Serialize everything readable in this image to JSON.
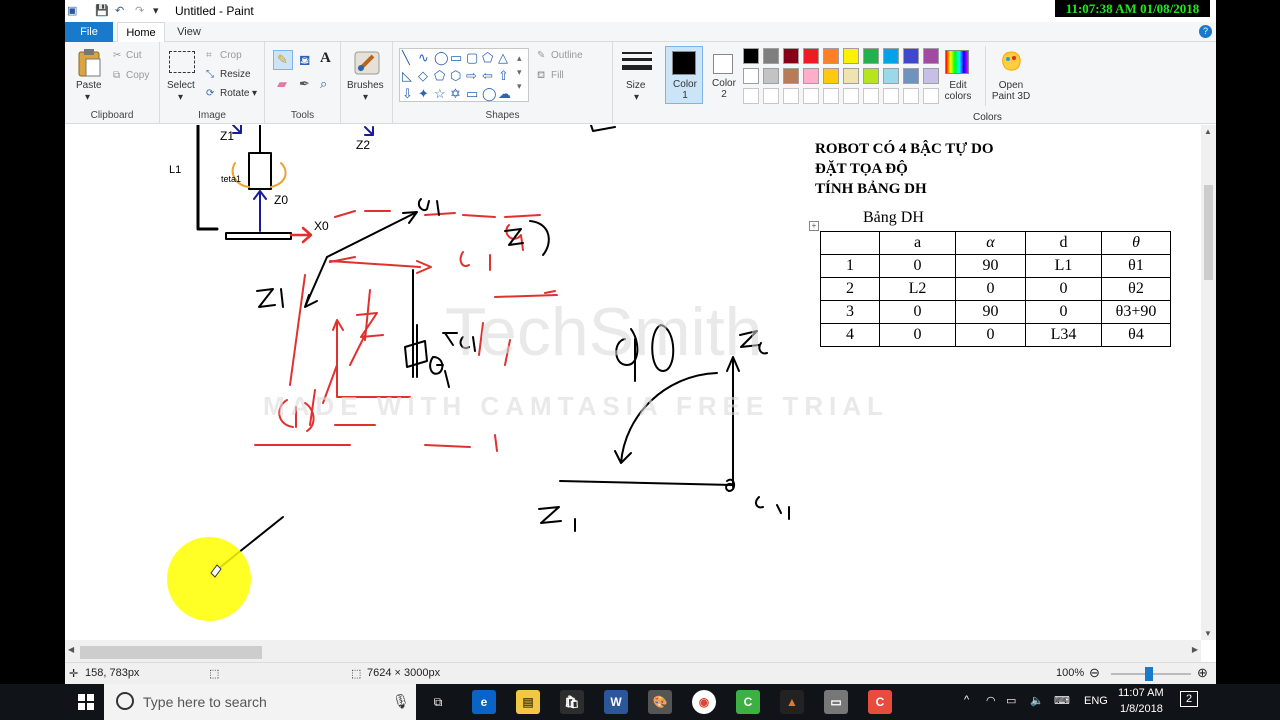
{
  "clock_overlay": "11:07:38 AM 01/08/2018",
  "window": {
    "title": "Untitled - Paint"
  },
  "tabs": {
    "file": "File",
    "home": "Home",
    "view": "View"
  },
  "ribbon": {
    "clipboard": {
      "paste": "Paste",
      "cut": "Cut",
      "copy": "Copy",
      "label": "Clipboard"
    },
    "image": {
      "select": "Select",
      "crop": "Crop",
      "resize": "Resize",
      "rotate": "Rotate",
      "label": "Image"
    },
    "tools": {
      "label": "Tools"
    },
    "brushes": "Brushes",
    "shapes": {
      "outline": "Outline",
      "fill": "Fill",
      "label": "Shapes"
    },
    "size": "Size",
    "color1": "Color 1",
    "color2": "Color 2",
    "edit_colors": "Edit colors",
    "open_paint3d": "Open Paint 3D",
    "colors_label": "Colors",
    "palette_row1": [
      "#000000",
      "#7f7f7f",
      "#880015",
      "#ed1c24",
      "#ff7f27",
      "#fff200",
      "#22b14c",
      "#00a2e8",
      "#3f48cc",
      "#a349a4"
    ],
    "palette_row2": [
      "#ffffff",
      "#c3c3c3",
      "#b97a57",
      "#ffaec9",
      "#ffc90e",
      "#efe4b0",
      "#b5e61d",
      "#99d9ea",
      "#7092be",
      "#c8bfe7"
    ]
  },
  "canvas": {
    "heading": [
      "ROBOT CÓ 4 BẬC TỰ DO",
      "ĐẶT TỌA ĐỘ",
      "TÍNH BẢNG DH"
    ],
    "table_caption": "Bảng DH",
    "table_header": [
      "",
      "a",
      "α",
      "d",
      "θ"
    ],
    "table_rows": [
      [
        "1",
        "0",
        "90",
        "L1",
        "θ1"
      ],
      [
        "2",
        "L2",
        "0",
        "0",
        "θ2"
      ],
      [
        "3",
        "0",
        "90",
        "0",
        "θ3+90"
      ],
      [
        "4",
        "0",
        "0",
        "L34",
        "θ4"
      ]
    ],
    "sketch_labels": {
      "z1": "Z1",
      "z2": "Z2",
      "z0": "Z0",
      "x0": "X0",
      "l1": "L1",
      "teta1": "teta1",
      "z4": "Z4"
    },
    "watermark": {
      "brand": "TechSmith",
      "sub": "MADE WITH CAMTASIA FREE TRIAL"
    }
  },
  "status": {
    "position": "158, 783px",
    "canvas_size": "7624 × 3000px",
    "zoom": "100%"
  },
  "taskbar": {
    "search_placeholder": "Type here to search",
    "lang": "ENG",
    "time": "11:07 AM",
    "date": "1/8/2018",
    "notifications": "2"
  }
}
